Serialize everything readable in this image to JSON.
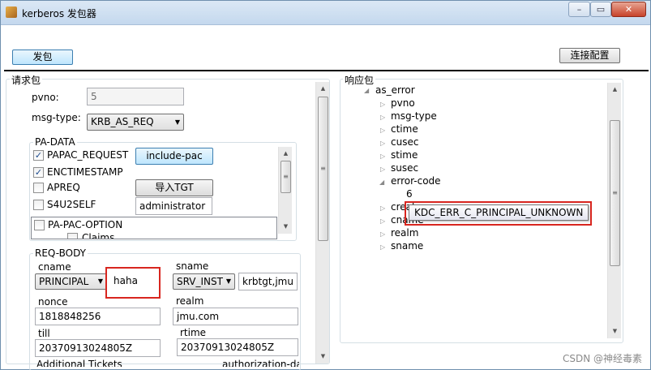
{
  "window": {
    "title": "kerberos 发包器",
    "controls": [
      "–",
      "▭",
      "✕"
    ]
  },
  "toolbar": {
    "send_label": "发包",
    "config_label": "连接配置"
  },
  "request": {
    "group_label": "请求包",
    "pvno_label": "pvno:",
    "pvno_value": "5",
    "msgtype_label": "msg-type:",
    "msgtype_value": "KRB_AS_REQ",
    "padata": {
      "group_label": "PA-DATA",
      "items": [
        {
          "label": "PAPAC_REQUEST",
          "checked": true
        },
        {
          "label": "ENCTIMESTAMP",
          "checked": true
        },
        {
          "label": "APREQ",
          "checked": false
        },
        {
          "label": "S4U2SELF",
          "checked": false
        }
      ],
      "include_pac_label": "include-pac",
      "import_tgt_label": "导入TGT",
      "user_value": "administrator",
      "papac_option_label": "PA-PAC-OPTION",
      "claims_label": "Claims"
    },
    "reqbody": {
      "group_label": "REQ-BODY",
      "cname_label": "cname",
      "cname_type": "PRINCIPAL",
      "cname_value": "haha",
      "sname_label": "sname",
      "sname_type": "SRV_INST",
      "sname_value": "krbtgt,jmu",
      "nonce_label": "nonce",
      "nonce_value": "1818848256",
      "realm_label": "realm",
      "realm_value": "jmu.com",
      "till_label": "till",
      "till_value": "20370913024805Z",
      "rtime_label": "rtime",
      "rtime_value": "20370913024805Z",
      "additional_label": "Additional Tickets",
      "authdata_label": "authorization-data"
    }
  },
  "response": {
    "group_label": "响应包",
    "tree": {
      "root": "as_error",
      "children": [
        "pvno",
        "msg-type",
        "ctime",
        "cusec",
        "stime",
        "susec",
        "error-code",
        "crealm",
        "cname",
        "realm",
        "sname"
      ],
      "error_code_value": "6"
    },
    "tooltip": "KDC_ERR_C_PRINCIPAL_UNKNOWN"
  },
  "watermark": "CSDN @神经毒素",
  "colors": {
    "highlight_red": "#d8261f",
    "button_focus": "#3c7fb1"
  }
}
